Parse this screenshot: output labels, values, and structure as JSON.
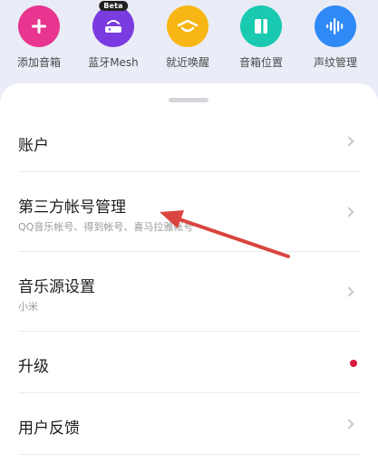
{
  "quick_actions": [
    {
      "label": "添加音箱",
      "icon": "plus-icon",
      "color": "#e8358f"
    },
    {
      "label": "蓝牙Mesh",
      "icon": "mesh-router-icon",
      "color": "#7a3be0",
      "badge": "Beta"
    },
    {
      "label": "就近唤醒",
      "icon": "wake-nearby-icon",
      "color": "#f7b614"
    },
    {
      "label": "音箱位置",
      "icon": "speaker-location-icon",
      "color": "#19c9b0"
    },
    {
      "label": "声纹管理",
      "icon": "voiceprint-icon",
      "color": "#2f8af5"
    }
  ],
  "menu": {
    "account": {
      "title": "账户"
    },
    "third_party": {
      "title": "第三方帐号管理",
      "subtitle": "QQ音乐帐号、得到帐号、喜马拉雅帐号"
    },
    "music_source": {
      "title": "音乐源设置",
      "subtitle": "小米"
    },
    "upgrade": {
      "title": "升级"
    },
    "feedback": {
      "title": "用户反馈"
    }
  },
  "colors": {
    "upgrade_dot": "#d6183f",
    "annotation_arrow": "#d9453f"
  }
}
